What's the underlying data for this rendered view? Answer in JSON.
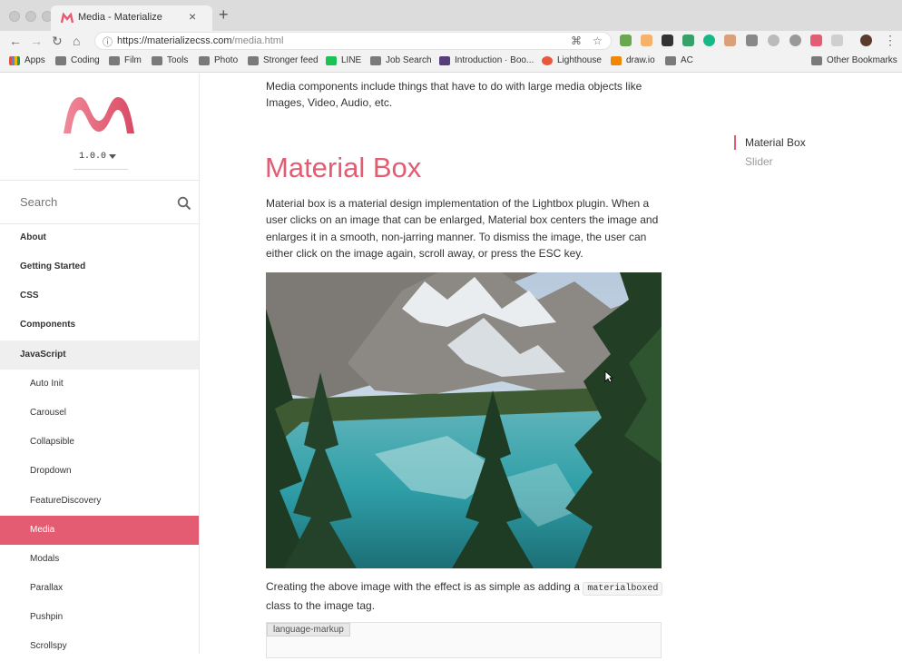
{
  "browser": {
    "tab_title": "Media - Materialize",
    "url_host": "https://materializecss.com",
    "url_path": "/media.html",
    "bookmarks": [
      "Apps",
      "Coding",
      "Film",
      "Tools",
      "Photo",
      "Stronger feed",
      "LINE",
      "Job Search",
      "Introduction · Boo...",
      "Lighthouse",
      "draw.io",
      "AC"
    ],
    "other_bookmarks": "Other Bookmarks"
  },
  "sidebar": {
    "version": "1.0.0",
    "search_placeholder": "Search",
    "top_items": [
      "About",
      "Getting Started",
      "CSS",
      "Components",
      "JavaScript"
    ],
    "sub_items": [
      "Auto Init",
      "Carousel",
      "Collapsible",
      "Dropdown",
      "FeatureDiscovery",
      "Media",
      "Modals",
      "Parallax",
      "Pushpin",
      "Scrollspy"
    ],
    "active_item": "Media"
  },
  "main": {
    "intro": "Media components include things that have to do with large media objects like Images, Video, Audio, etc.",
    "heading": "Material Box",
    "paragraph": "Material box is a material design implementation of the Lightbox plugin. When a user clicks on an image that can be enlarged, Material box centers the image and enlarges it in a smooth, non-jarring manner. To dismiss the image, the user can either click on the image again, scroll away, or press the ESC key.",
    "para2_before": "Creating the above image with the effect is as simple as adding a ",
    "para2_code": "materialboxed",
    "para2_after": " class to the image tag.",
    "code_label": "language-markup"
  },
  "toc": [
    "Material Box",
    "Slider"
  ],
  "colors": {
    "accent": "#e35c72",
    "text": "#333333"
  }
}
